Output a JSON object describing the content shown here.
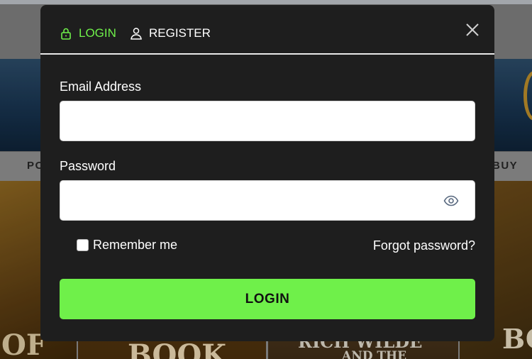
{
  "background": {
    "nav_left": "PO",
    "nav_right": "BUY",
    "tile1_text": "OF",
    "tile2_text": "BOOK",
    "tile3_text": "RICH WILDE",
    "tile3_sub": "AND THE",
    "tile4_text": "BO"
  },
  "modal": {
    "tabs": [
      {
        "label": "LOGIN",
        "icon": "lock-icon",
        "active": true
      },
      {
        "label": "REGISTER",
        "icon": "user-icon",
        "active": false
      }
    ],
    "close_icon": "close-icon",
    "email": {
      "label": "Email Address",
      "value": "",
      "placeholder": ""
    },
    "password": {
      "label": "Password",
      "value": "",
      "placeholder": "",
      "toggle_icon": "eye-icon"
    },
    "remember_label": "Remember me",
    "remember_checked": false,
    "forgot_label": "Forgot password?",
    "submit_label": "LOGIN"
  },
  "colors": {
    "accent": "#6ff04a",
    "modal_bg": "#1e1e1e",
    "text": "#ffffff"
  }
}
